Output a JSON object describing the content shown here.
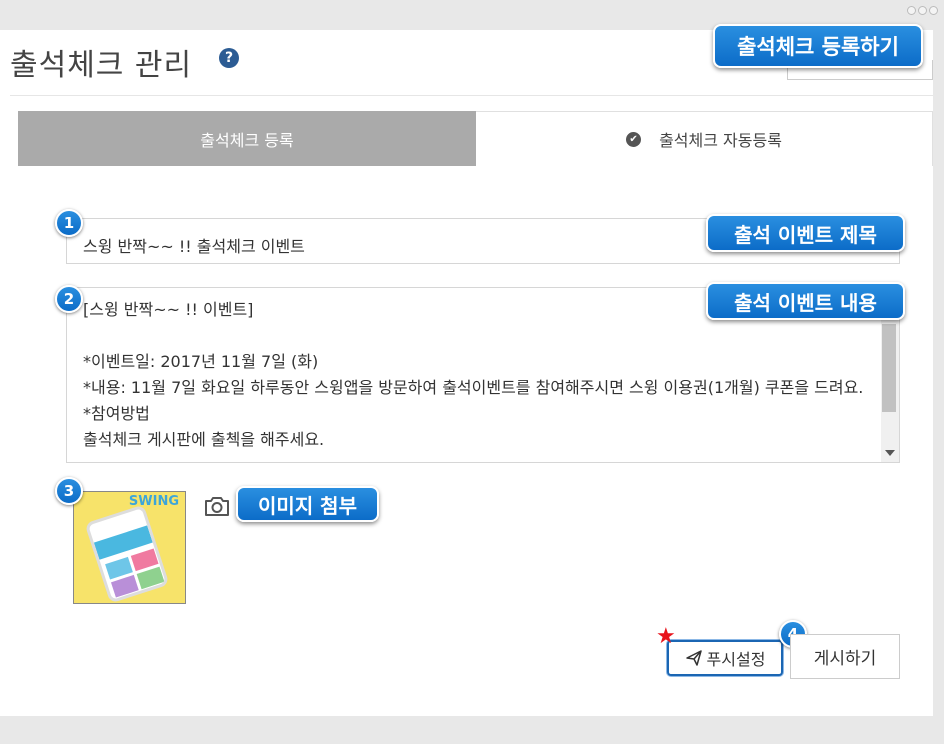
{
  "page": {
    "title": "출석체크 관리",
    "help_icon": "question-circle-icon"
  },
  "tabs": [
    {
      "label": "출석체크 등록",
      "active": true
    },
    {
      "label": "출석체크 자동등록",
      "active": false,
      "icon": "check-circle-icon"
    }
  ],
  "form": {
    "title_value": "스윙 반짝~~ !! 출석체크 이벤트",
    "content_value": "[스윙 반짝~~ !! 이벤트]\n\n*이벤트일: 2017년 11월 7일 (화)\n*내용: 11월 7일 화요일 하루동안 스윙앱을 방문하여 출석이벤트를 참여해주시면 스윙 이용권(1개월) 쿠폰을 드려요.\n*참여방법\n출석체크 게시판에 출첵을 해주세요.",
    "attachment_thumb_text": "SWING",
    "camera_icon": "camera-icon"
  },
  "buttons": {
    "push_settings": "푸시설정",
    "post": "게시하기"
  },
  "annotations": {
    "register_callout": "출석체크 등록하기",
    "title_callout": "출석 이벤트 제목",
    "content_callout": "출석 이벤트 내용",
    "image_callout": "이미지 첨부",
    "badges": [
      "1",
      "2",
      "3",
      "4"
    ]
  },
  "colors": {
    "callout": "#1a7fd6",
    "active_tab": "#aaaaaa",
    "push_border": "#1b66b3",
    "star": "#e8141c"
  }
}
